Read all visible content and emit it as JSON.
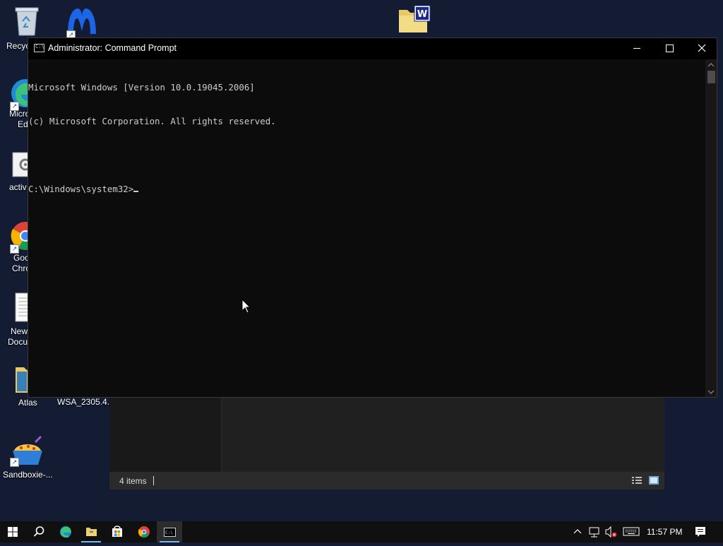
{
  "desktop": {
    "icons": [
      {
        "label": "Recyc",
        "icon": "recycle-bin-icon"
      },
      {
        "label": "",
        "icon": "malwarebytes-icon"
      },
      {
        "label": "",
        "icon": "folder-winword-icon"
      },
      {
        "label_line1": "Micro",
        "label_line2": "Ed",
        "icon": "edge-icon"
      },
      {
        "label": "activ",
        "icon": "settings-file-icon"
      },
      {
        "label_line1": "Goo",
        "label_line2": "Chro",
        "icon": "chrome-icon"
      },
      {
        "label_line1": "New",
        "label_line2": "Docu",
        "icon": "text-document-icon"
      },
      {
        "label": "Atlas",
        "icon": "atlas-folder-icon"
      },
      {
        "label": "WSA_2305.4...",
        "icon": "wsa-icon"
      },
      {
        "label": "Sandboxie-...",
        "icon": "sandboxie-icon"
      }
    ]
  },
  "explorer": {
    "status_count": "4 items"
  },
  "cmd": {
    "title": "Administrator: Command Prompt",
    "title_icon": "C:\\",
    "lines": [
      "Microsoft Windows [Version 10.0.19045.2006]",
      "(c) Microsoft Corporation. All rights reserved.",
      "",
      "C:\\Windows\\system32>"
    ]
  },
  "taskbar": {
    "apps": [
      "start-icon",
      "search-icon",
      "edge-icon",
      "file-explorer-icon",
      "store-icon",
      "chrome-icon",
      "cmd-icon"
    ],
    "active_app": "cmd-icon",
    "clock": "11:57 PM",
    "accent": "#76b9ed"
  }
}
